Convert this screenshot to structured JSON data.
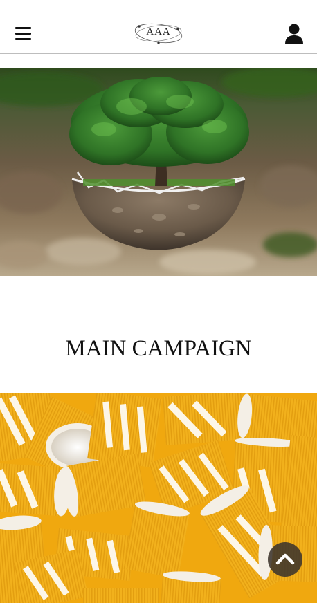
{
  "header": {
    "menu_icon": "hamburger-menu-icon",
    "logo_text": "AAA",
    "user_icon": "user-icon"
  },
  "hero": {
    "image": "tree-in-soil-sphere-photo"
  },
  "main": {
    "campaign_title": "MAIN CAMPAIGN",
    "campaign_image": "yellow-paper-cups-photo"
  },
  "scroll_top": {
    "icon": "chevron-up-icon"
  },
  "colors": {
    "accent_yellow": "#f2b11c",
    "cup_white": "#f4efe6",
    "header_border": "#bdbdbd",
    "scroll_button": "#3c342c"
  }
}
